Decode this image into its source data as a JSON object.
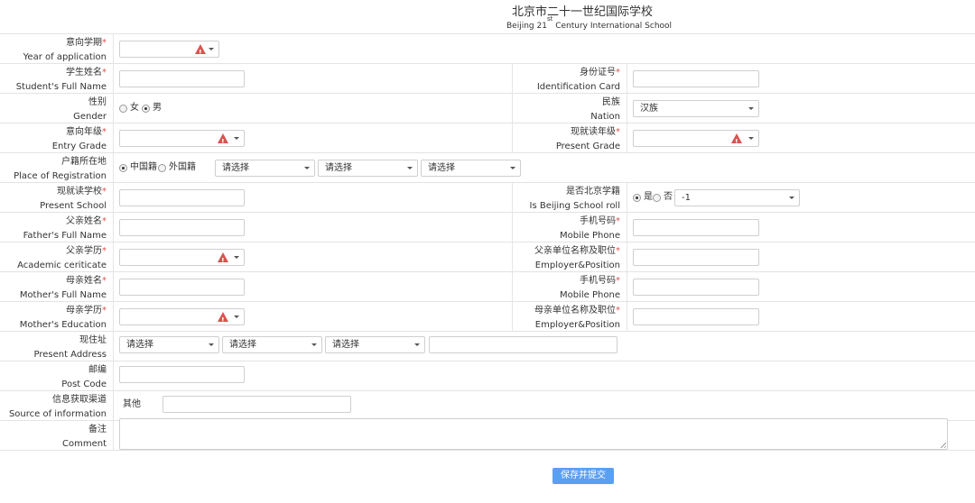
{
  "header": {
    "school_name_cn": "北京市二十一世纪国际学校",
    "school_name_en_prefix": "Beijing 21",
    "school_name_en_sup": "st",
    "school_name_en_suffix": " Century International School"
  },
  "fields": {
    "year_of_application": {
      "cn": "意向学期",
      "en": "Year of application",
      "required": "*"
    },
    "student_name": {
      "cn": "学生姓名",
      "en": "Student's Full Name",
      "required": "*"
    },
    "identification_card": {
      "cn": "身份证号",
      "en": "Identification Card",
      "required": "*"
    },
    "gender": {
      "cn": "性别",
      "en": "Gender",
      "option_female": "女",
      "option_male": "男",
      "selected": "男"
    },
    "nation": {
      "cn": "民族",
      "en": "Nation",
      "value": "汉族"
    },
    "entry_grade": {
      "cn": "意向年级",
      "en": "Entry Grade",
      "required": "*"
    },
    "present_grade": {
      "cn": "现就读年级",
      "en": "Present Grade",
      "required": "*"
    },
    "place_of_registration": {
      "cn": "户籍所在地",
      "en": "Place of Registration",
      "option_domestic": "中国籍",
      "option_foreign": "外国籍",
      "selected": "中国籍",
      "province": "请选择",
      "city": "请选择",
      "district": "请选择"
    },
    "present_school": {
      "cn": "现就读学校",
      "en": "Present School",
      "required": "*"
    },
    "beijing_school_roll": {
      "cn": "是否北京学籍",
      "en": "Is Beijing School roll",
      "option_yes": "是",
      "option_no": "否",
      "selected": "是",
      "value": "-1"
    },
    "father_name": {
      "cn": "父亲姓名",
      "en": "Father's Full Name",
      "required": "*"
    },
    "father_mobile": {
      "cn": "手机号码",
      "en": "Mobile Phone",
      "required": "*"
    },
    "father_education": {
      "cn": "父亲学历",
      "en": "Academic ceriticate",
      "required": "*"
    },
    "father_employer": {
      "cn": "父亲单位名称及职位",
      "en": "Employer&Position",
      "required": "*"
    },
    "mother_name": {
      "cn": "母亲姓名",
      "en": "Mother's Full Name",
      "required": "*"
    },
    "mother_mobile": {
      "cn": "手机号码",
      "en": "Mobile Phone",
      "required": "*"
    },
    "mother_education": {
      "cn": "母亲学历",
      "en": "Mother's Education",
      "required": "*"
    },
    "mother_employer": {
      "cn": "母亲单位名称及职位",
      "en": "Employer&Position",
      "required": "*"
    },
    "present_address": {
      "cn": "现住址",
      "en": "Present Address",
      "province": "请选择",
      "city": "请选择",
      "district": "请选择"
    },
    "post_code": {
      "cn": "邮编",
      "en": "Post Code"
    },
    "source_of_information": {
      "cn": "信息获取渠道",
      "en": "Source of information",
      "other_label": "其他"
    },
    "comment": {
      "cn": "备注",
      "en": "Comment"
    }
  },
  "icons": {
    "warning": "warning-icon",
    "dropdown": "caret-down-icon"
  },
  "colors": {
    "required": "#d9534f",
    "warning": "#d9534f",
    "submit": "#5b9ff2"
  },
  "submit_label": "保存并提交"
}
